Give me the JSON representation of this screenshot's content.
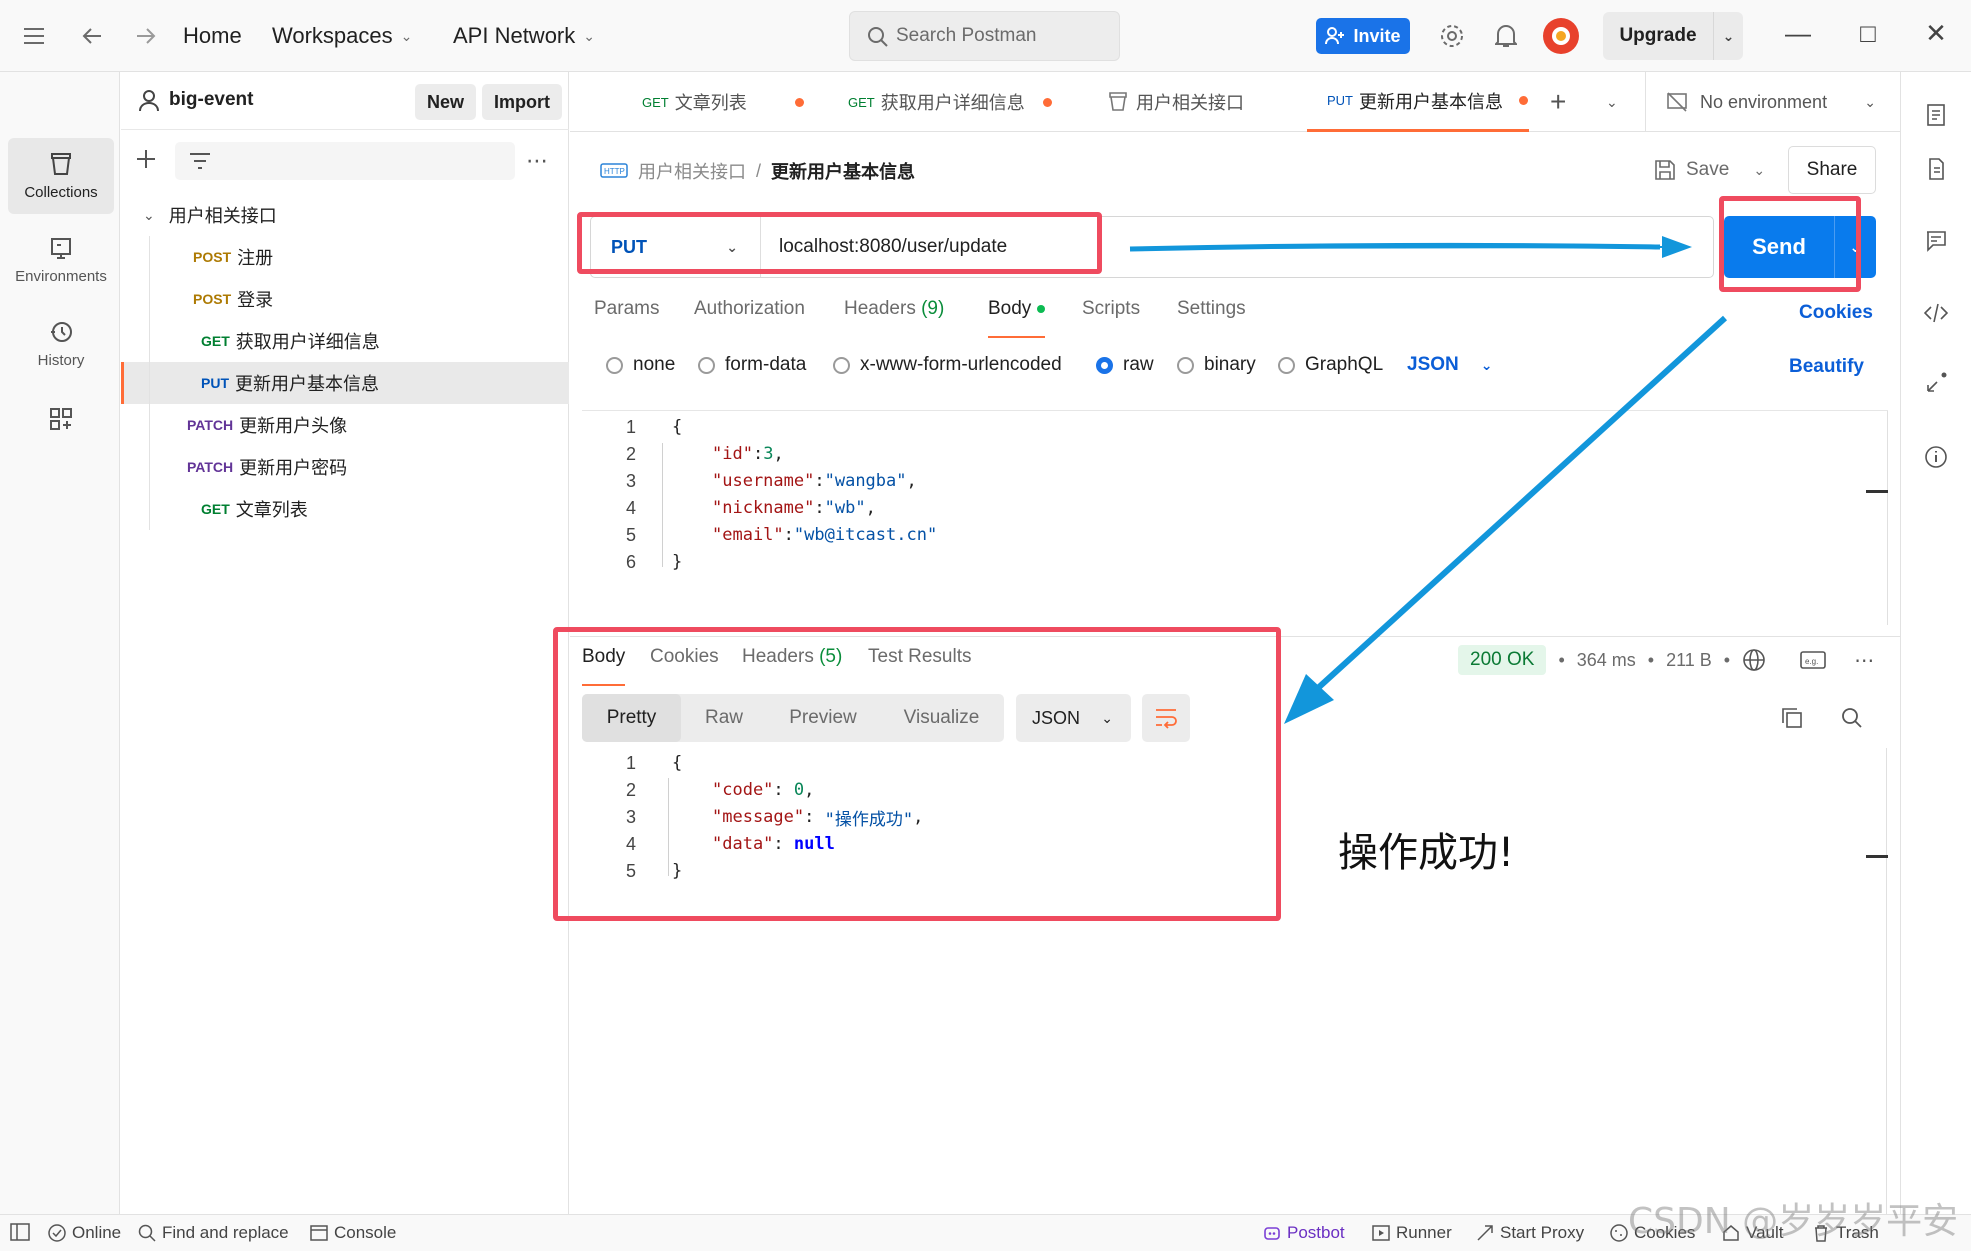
{
  "topbar": {
    "nav_home": "Home",
    "nav_workspaces": "Workspaces",
    "nav_api_network": "API Network",
    "search_placeholder": "Search Postman",
    "invite_label": "Invite",
    "upgrade_label": "Upgrade"
  },
  "rail": {
    "items": [
      {
        "label": "Collections",
        "icon": "collections-icon"
      },
      {
        "label": "Environments",
        "icon": "environments-icon"
      },
      {
        "label": "History",
        "icon": "history-icon"
      }
    ]
  },
  "sidebar": {
    "workspace_name": "big-event",
    "new_label": "New",
    "import_label": "Import",
    "folder": "用户相关接口",
    "requests": [
      {
        "method": "POST",
        "name": "注册"
      },
      {
        "method": "POST",
        "name": "登录"
      },
      {
        "method": "GET",
        "name": "获取用户详细信息"
      },
      {
        "method": "PUT",
        "name": "更新用户基本信息"
      },
      {
        "method": "PATCH",
        "name": "更新用户头像"
      },
      {
        "method": "PATCH",
        "name": "更新用户密码"
      },
      {
        "method": "GET",
        "name": "文章列表"
      }
    ]
  },
  "tabs": [
    {
      "method": "GET",
      "name": "文章列表"
    },
    {
      "method": "GET",
      "name": "获取用户详细信息"
    },
    {
      "method": "",
      "name": "用户相关接口"
    },
    {
      "method": "PUT",
      "name": "更新用户基本信息"
    }
  ],
  "environment": "No environment",
  "request": {
    "breadcrumb_parent": "用户相关接口",
    "breadcrumb_sep": "/",
    "breadcrumb_current": "更新用户基本信息",
    "save_label": "Save",
    "share_label": "Share",
    "method": "PUT",
    "url": "localhost:8080/user/update",
    "send_label": "Send",
    "tabs": {
      "params": "Params",
      "authorization": "Authorization",
      "headers": "Headers",
      "headers_count": "(9)",
      "body": "Body",
      "scripts": "Scripts",
      "settings": "Settings"
    },
    "cookies_label": "Cookies",
    "body_types": [
      "none",
      "form-data",
      "x-www-form-urlencoded",
      "raw",
      "binary",
      "GraphQL"
    ],
    "selected_body_type": "raw",
    "format": "JSON",
    "beautify_label": "Beautify",
    "body_lines": [
      {
        "n": "1",
        "t": "{"
      },
      {
        "n": "2",
        "k": "\"id\"",
        "sep": ":",
        "v": "3",
        "vt": "num",
        "end": ","
      },
      {
        "n": "3",
        "k": "\"username\"",
        "sep": ":",
        "v": "\"wangba\"",
        "vt": "str",
        "end": ","
      },
      {
        "n": "4",
        "k": "\"nickname\"",
        "sep": ":",
        "v": "\"wb\"",
        "vt": "str",
        "end": ","
      },
      {
        "n": "5",
        "k": "\"email\"",
        "sep": ":",
        "v": "\"wb@itcast.cn\"",
        "vt": "str",
        "end": ""
      },
      {
        "n": "6",
        "t": "}"
      }
    ]
  },
  "response": {
    "tabs": {
      "body": "Body",
      "cookies": "Cookies",
      "headers": "Headers",
      "headers_count": "(5)",
      "test_results": "Test Results"
    },
    "status": "200 OK",
    "time": "364 ms",
    "size": "211 B",
    "views": [
      "Pretty",
      "Raw",
      "Preview",
      "Visualize"
    ],
    "format": "JSON",
    "body_lines": [
      {
        "n": "1",
        "t": "{"
      },
      {
        "n": "2",
        "k": "\"code\"",
        "sep": ": ",
        "v": "0",
        "vt": "num",
        "end": ","
      },
      {
        "n": "3",
        "k": "\"message\"",
        "sep": ": ",
        "v": "\"操作成功\"",
        "vt": "str",
        "end": ","
      },
      {
        "n": "4",
        "k": "\"data\"",
        "sep": ": ",
        "v": "null",
        "vt": "kw",
        "end": ""
      },
      {
        "n": "5",
        "t": "}"
      }
    ]
  },
  "annotation": "操作成功!",
  "statusbar": {
    "online": "Online",
    "find_replace": "Find and replace",
    "console": "Console",
    "postbot": "Postbot",
    "runner": "Runner",
    "start_proxy": "Start Proxy",
    "cookies": "Cookies",
    "vault": "Vault",
    "trash": "Trash"
  },
  "watermark": "CSDN @岁岁岁平安",
  "colors": {
    "accent": "#ff6c37",
    "send_blue": "#097bed",
    "highlight_red": "#ef4b5f",
    "arrow_blue": "#1296db",
    "status_ok": "#0b7a35"
  }
}
